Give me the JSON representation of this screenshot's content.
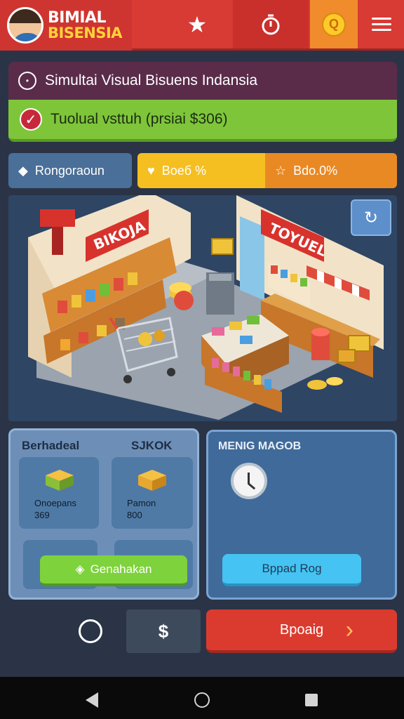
{
  "header": {
    "brand_line1": "BIMIAL",
    "brand_line2": "BISENSIA"
  },
  "banner": {
    "title": "Simultai Visual Bisuens Indansia",
    "status": "Tuolual vsttuh (prsiai $306)"
  },
  "stats": [
    {
      "label": "Rongoraoun",
      "icon": "tag-icon",
      "color": "#4a6f98"
    },
    {
      "label": "Boeб %",
      "icon": "heart-icon",
      "color": "#f5bf22"
    },
    {
      "label": "Bdo.0%",
      "icon": "star-icon",
      "color": "#e98924"
    }
  ],
  "scene": {
    "sign_left": "BIKOJA",
    "sign_right": "TOYUEL"
  },
  "stock_panel": {
    "tab1": "Berhadeal",
    "tab2": "SJKOK",
    "card1_line1": "Onoepans",
    "card1_line2": "369",
    "card2_line1": "Pamon",
    "card2_line2": "800",
    "button_label": "Genahakan"
  },
  "manage_panel": {
    "title": "MENIG MAGOB",
    "button_label": "Bppad Rog"
  },
  "actions": {
    "main_button": "Bpoaig"
  },
  "colors": {
    "accent_red": "#d83a34",
    "accent_green": "#7ec53a",
    "accent_blue": "#45c3f2",
    "accent_yellow": "#f5bf22"
  }
}
